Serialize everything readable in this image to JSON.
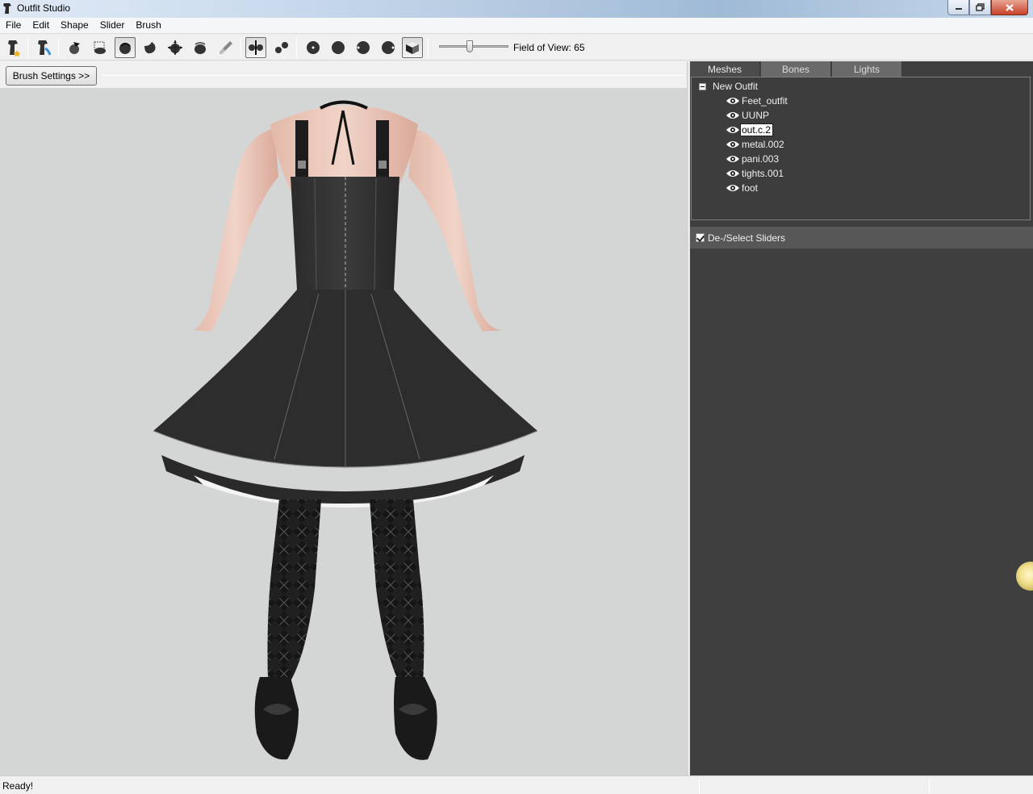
{
  "window": {
    "title": "Outfit Studio"
  },
  "menu": [
    "File",
    "Edit",
    "Shape",
    "Slider",
    "Brush"
  ],
  "toolbar": {
    "field_of_view_label": "Field of View: 65",
    "fov_value": 65
  },
  "brush_settings_label": "Brush Settings >>",
  "tabs": [
    "Meshes",
    "Bones",
    "Lights"
  ],
  "active_tab": "Meshes",
  "tree": {
    "root": "New Outfit",
    "items": [
      "Feet_outfit",
      "UUNP",
      "out.c.2",
      "metal.002",
      "pani.003",
      "tights.001",
      "foot"
    ],
    "selected": "out.c.2"
  },
  "sliders_header": "De-/Select Sliders",
  "status": {
    "text": "Ready!"
  },
  "colors": {
    "panel_bg": "#3f3f3f",
    "viewport_bg": "#d4d5d5",
    "tab_bg": "#6a6a6a"
  }
}
